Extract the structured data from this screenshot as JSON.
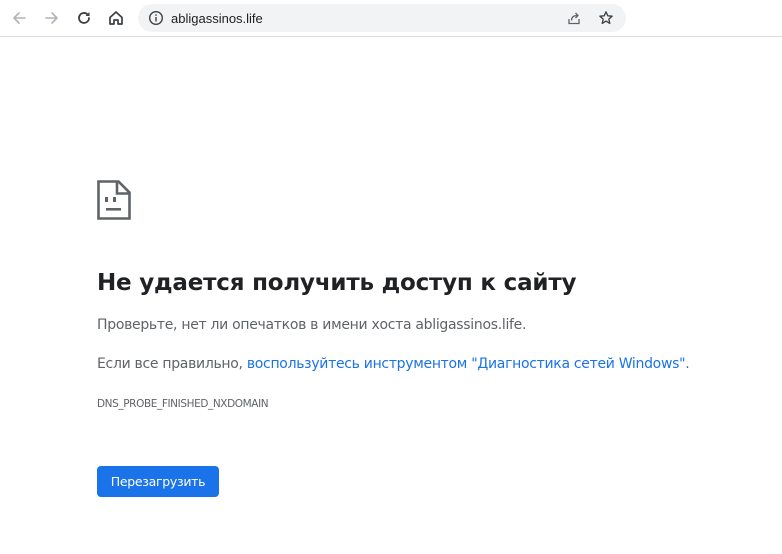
{
  "browser": {
    "url": "abligassinos.life",
    "icons": {
      "back": "arrow-left-icon",
      "forward": "arrow-right-icon",
      "reload": "reload-icon",
      "home": "home-icon",
      "info": "info-icon",
      "share": "share-icon",
      "bookmark": "star-icon"
    }
  },
  "error_page": {
    "icon": "sad-document-icon",
    "title": "Не удается получить доступ к сайту",
    "check_text": "Проверьте, нет ли опечатков в имени хоста abligassinos.life.",
    "correct_prefix": "Если все правильно, ",
    "diagnostics_link": "воспользуйтесь инструментом \"Диагностика сетей Windows\"",
    "correct_suffix": ".",
    "error_code": "DNS_PROBE_FINISHED_NXDOMAIN",
    "reload_button": "Перезагрузить"
  },
  "colors": {
    "accent": "#1a73e8",
    "secondary_text": "#5f6368",
    "title_text": "#202124",
    "omnibox_bg": "#f1f3f4"
  }
}
